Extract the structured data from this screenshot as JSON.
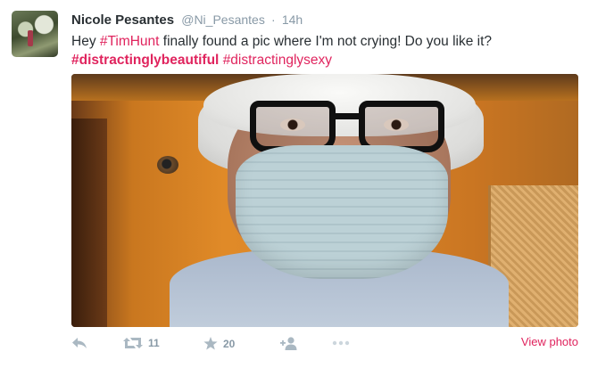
{
  "user": {
    "name": "Nicole Pesantes",
    "handle": "@Ni_Pesantes",
    "separator": "·",
    "time": "14h"
  },
  "tweet": {
    "text_part1": "Hey ",
    "hashtag1": "#TimHunt",
    "text_part2": " finally found a pic where I'm not crying! Do you like it?",
    "hashtag2": "#distractinglybeautiful",
    "hashtag3": "#distractinglysexy"
  },
  "actions": {
    "reply_icon": "reply-icon",
    "retweet_icon": "retweet-icon",
    "retweet_count": "11",
    "favorite_icon": "star-icon",
    "favorite_count": "20",
    "follow_icon": "follow-icon",
    "more_icon": "more-icon",
    "view_photo": "View photo"
  },
  "colors": {
    "accent": "#e0245e",
    "muted": "#8899a6",
    "text": "#292f33"
  }
}
